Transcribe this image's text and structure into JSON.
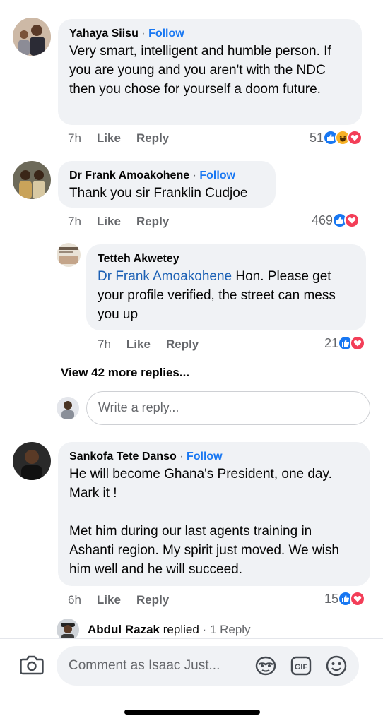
{
  "comments": [
    {
      "author": "Yahaya Siisu",
      "follow": "Follow",
      "text": "Very smart, intelligent and humble person. If you are young and you aren't with the NDC then you chose for yourself a doom future.",
      "time": "7h",
      "like": "Like",
      "reply": "Reply",
      "reaction_count": "51",
      "reaction_icons": [
        "like-icon",
        "haha-icon",
        "love-icon"
      ]
    },
    {
      "author": "Dr Frank Amoakohene",
      "follow": "Follow",
      "text": "Thank you sir Franklin Cudjoe",
      "time": "7h",
      "like": "Like",
      "reply": "Reply",
      "reaction_count": "469",
      "reaction_icons": [
        "like-icon",
        "love-icon"
      ]
    },
    {
      "author": "Sankofa Tete Danso",
      "follow": "Follow",
      "text": "He will become Ghana's President, one day. Mark it !\n\nMet him during our last agents training in Ashanti region. My spirit just moved. We wish him well and he will succeed.",
      "time": "6h",
      "like": "Like",
      "reply": "Reply",
      "reaction_count": "15",
      "reaction_icons": [
        "like-icon",
        "love-icon"
      ]
    }
  ],
  "nested_reply": {
    "author": "Tetteh Akwetey",
    "mention": "Dr Frank Amoakohene",
    "text": " Hon. Please get your profile verified,  the street can mess you up",
    "time": "7h",
    "like": "Like",
    "reply": "Reply",
    "reaction_count": "21",
    "reaction_icons": [
      "like-icon",
      "love-icon"
    ]
  },
  "view_more_replies": "View 42 more replies...",
  "reply_input": {
    "placeholder": "Write a reply..."
  },
  "replied_preview": {
    "author": "Abdul Razak",
    "action": " replied",
    "separator": " · ",
    "count": "1 Reply"
  },
  "composer": {
    "placeholder": "Comment as Isaac Just...",
    "icons": [
      "camera-icon",
      "avatar-sticker-icon",
      "gif-icon",
      "emoji-icon"
    ]
  },
  "colors": {
    "accent": "#1877f2",
    "love": "#f33e58",
    "haha": "#f7b125",
    "bubble": "#f0f2f5"
  }
}
